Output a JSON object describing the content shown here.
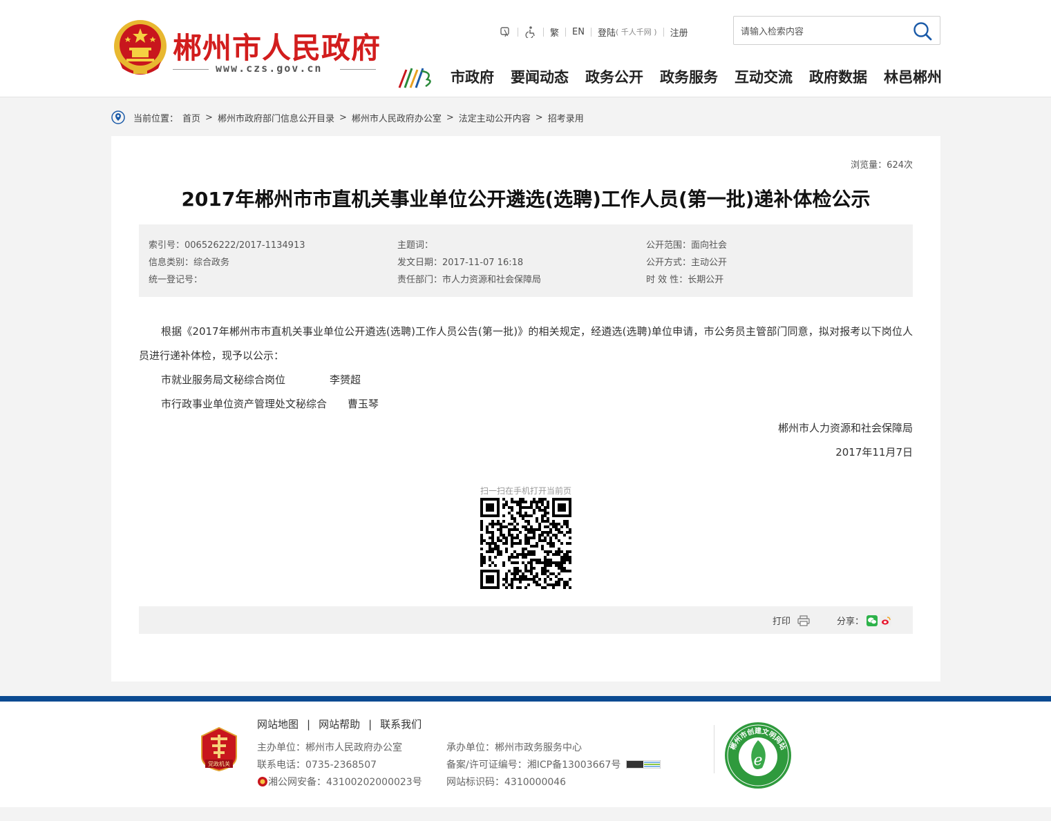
{
  "header": {
    "site_title": "郴州市人民政府",
    "site_url": "www.czs.gov.cn",
    "top_links": {
      "traditional": "繁",
      "english": "EN",
      "login": "登陆",
      "login_note": "( 千人千网 )",
      "register": "注册"
    },
    "search": {
      "placeholder": "请输入检索内容"
    },
    "nav": [
      "市政府",
      "要闻动态",
      "政务公开",
      "政务服务",
      "互动交流",
      "政府数据",
      "林邑郴州"
    ]
  },
  "breadcrumb": {
    "label": "当前位置：",
    "items": [
      "首页",
      "郴州市政府部门信息公开目录",
      "郴州市人民政府办公室",
      "法定主动公开内容",
      "招考录用"
    ]
  },
  "article": {
    "views": "浏览量：624次",
    "title": "2017年郴州市市直机关事业单位公开遴选(选聘)工作人员(第一批)递补体检公示",
    "meta": {
      "index_no": "索引号：006526222/2017-1134913",
      "category": "信息类别：综合政务",
      "reg_no": "统一登记号：",
      "subject": "主题词：",
      "date": "发文日期：2017-11-07 16:18",
      "dept": "责任部门：市人力资源和社会保障局",
      "scope": "公开范围：面向社会",
      "method": "公开方式：主动公开",
      "validity": "时 效 性：长期公开"
    },
    "paragraph": "根据《2017年郴州市市直机关事业单位公开遴选(选聘)工作人员公告(第一批)》的相关规定，经遴选(选聘)单位申请，市公务员主管部门同意，拟对报考以下岗位人员进行递补体检，现予以公示：",
    "rows": [
      {
        "post": "市就业服务局文秘综合岗位",
        "name": "李赟超"
      },
      {
        "post": "市行政事业单位资产管理处文秘综合",
        "name": "曹玉琴"
      }
    ],
    "signer": "郴州市人力资源和社会保障局",
    "sign_date": "2017年11月7日",
    "qr_label": "扫一扫在手机打开当前页",
    "print": "打印",
    "share": "分享："
  },
  "footer": {
    "links": [
      "网站地图",
      "网站帮助",
      "联系我们"
    ],
    "host": "主办单位：郴州市人民政府办公室",
    "phone": "联系电话：0735-2368507",
    "police": "湘公网安备：43100202000023号",
    "undertake": "承办单位：郴州市政务服务中心",
    "icp": "备案/许可证编号：湘ICP备13003667号",
    "site_code": "网站标识码：4310000046",
    "badge_text": "党政机关",
    "seal_text": "郴州市创建文明网站"
  },
  "colors": {
    "brand_red": "#d21d1d",
    "footer_blue": "#0b4a91"
  }
}
